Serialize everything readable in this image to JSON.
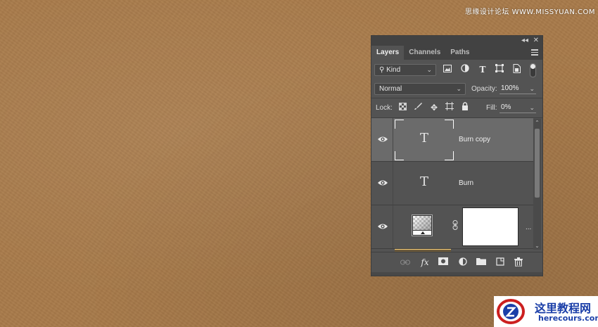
{
  "watermark_top": "思缘设计论坛 WWW.MISSYUAN.COM",
  "panel": {
    "tabs": [
      {
        "label": "Layers",
        "active": true
      },
      {
        "label": "Channels",
        "active": false
      },
      {
        "label": "Paths",
        "active": false
      }
    ],
    "filter": {
      "kind_label": "Kind"
    },
    "blend": {
      "mode": "Normal",
      "opacity_label": "Opacity:",
      "opacity_value": "100%"
    },
    "lock": {
      "label": "Lock:",
      "fill_label": "Fill:",
      "fill_value": "0%"
    },
    "layers": [
      {
        "name": "Burn copy",
        "type": "text",
        "thumb_glyph": "T",
        "selected": true
      },
      {
        "name": "Burn",
        "type": "text",
        "thumb_glyph": "T",
        "selected": false
      },
      {
        "name": "",
        "type": "gradient-map-adjustment",
        "selected": false,
        "more": "..."
      }
    ],
    "bottom_icons": [
      "link-icon",
      "fx-icon",
      "mask-icon",
      "adjustment-icon",
      "folder-icon",
      "new-layer-icon",
      "trash-icon"
    ],
    "fx_label": "fx"
  },
  "watermark_bottom": {
    "cn": "这里教程网",
    "en": "herecours.com"
  },
  "colors": {
    "panel_bg": "#535353",
    "selected_row": "#6b6b6b",
    "leather": "#a87a4a"
  }
}
